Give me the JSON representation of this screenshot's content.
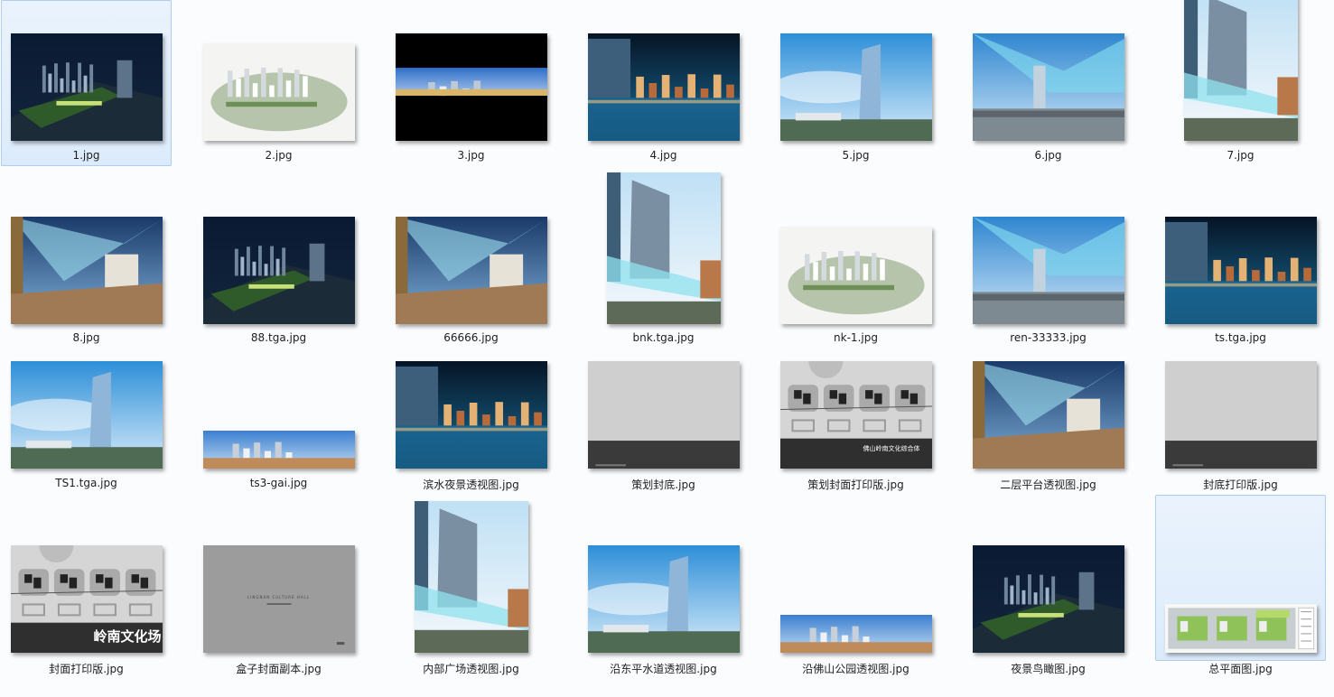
{
  "files": [
    {
      "name": "1.jpg",
      "style": "night-aerial",
      "selected": true
    },
    {
      "name": "2.jpg",
      "style": "fog-aerial"
    },
    {
      "name": "3.jpg",
      "style": "wide-strip-black"
    },
    {
      "name": "4.jpg",
      "style": "night-river"
    },
    {
      "name": "5.jpg",
      "style": "day-tower"
    },
    {
      "name": "6.jpg",
      "style": "plaza-canopy"
    },
    {
      "name": "7.jpg",
      "style": "tower-portrait"
    },
    {
      "name": "8.jpg",
      "style": "terrace-canopy"
    },
    {
      "name": "88.tga.jpg",
      "style": "night-aerial"
    },
    {
      "name": "66666.jpg",
      "style": "terrace-canopy"
    },
    {
      "name": "bnk.tga.jpg",
      "style": "tower-portrait"
    },
    {
      "name": "nk-1.jpg",
      "style": "fog-aerial"
    },
    {
      "name": "ren-33333.jpg",
      "style": "plaza-canopy"
    },
    {
      "name": "ts.tga.jpg",
      "style": "night-river"
    },
    {
      "name": "TS1.tga.jpg",
      "style": "day-tower"
    },
    {
      "name": "ts3-gai.jpg",
      "style": "wide-strip"
    },
    {
      "name": "滨水夜景透视图.jpg",
      "style": "night-river"
    },
    {
      "name": "策划封底.jpg",
      "style": "grey-cover"
    },
    {
      "name": "策划封面打印版.jpg",
      "style": "plan-cover"
    },
    {
      "name": "二层平台透视图.jpg",
      "style": "terrace-canopy"
    },
    {
      "name": "封底打印版.jpg",
      "style": "grey-cover"
    },
    {
      "name": "封面打印版.jpg",
      "style": "plan-cover-big"
    },
    {
      "name": "盒子封面副本.jpg",
      "style": "grey-box"
    },
    {
      "name": "内部广场透视图.jpg",
      "style": "tower-portrait"
    },
    {
      "name": "沿东平水道透视图.jpg",
      "style": "day-tower"
    },
    {
      "name": "沿佛山公园透视图.jpg",
      "style": "wide-strip"
    },
    {
      "name": "夜景鸟瞰图.jpg",
      "style": "night-aerial"
    },
    {
      "name": "总平面图.jpg",
      "style": "site-plan",
      "selected": true
    }
  ],
  "cover_texts": {
    "plan_cover_title": "佛山岭南文化综合体",
    "plan_cover_big_title": "岭南文化场",
    "box_cover_title": "LINGNAN CULTURE HALL"
  }
}
